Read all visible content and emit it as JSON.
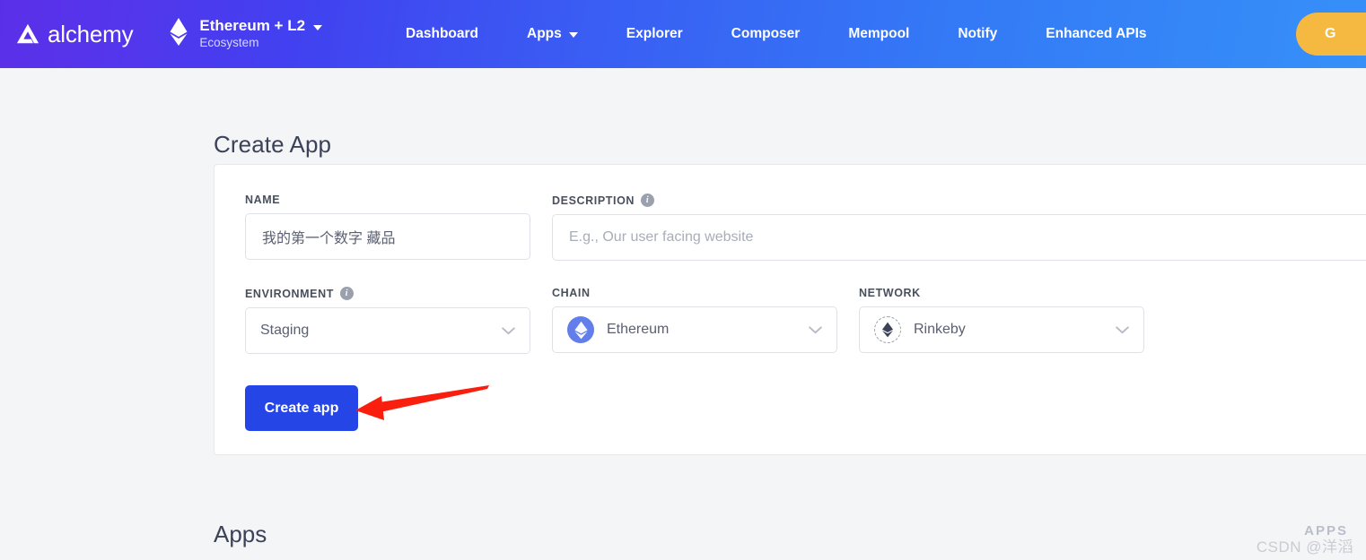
{
  "navbar": {
    "brand_name": "alchemy",
    "brand_logo_icon": "alchemy-triangle-logo",
    "ecosystem": {
      "icon": "ethereum-diamond-icon",
      "title": "Ethereum + L2",
      "subtitle": "Ecosystem",
      "caret_icon": "caret-down-icon"
    },
    "links": [
      {
        "label": "Dashboard",
        "has_caret": false
      },
      {
        "label": "Apps",
        "has_caret": true
      },
      {
        "label": "Explorer",
        "has_caret": false
      },
      {
        "label": "Composer",
        "has_caret": false
      },
      {
        "label": "Mempool",
        "has_caret": false
      },
      {
        "label": "Notify",
        "has_caret": false
      },
      {
        "label": "Enhanced APIs",
        "has_caret": false
      }
    ],
    "cta_label": "G",
    "gradient_start": "#5b2fe8",
    "gradient_end": "#3690f8",
    "cta_color": "#f5b942"
  },
  "create_app": {
    "heading": "Create App",
    "name": {
      "label": "NAME",
      "value": "我的第一个数字 藏品",
      "placeholder": "我的第一个数字 藏品"
    },
    "description": {
      "label": "DESCRIPTION",
      "info_icon": "info-icon",
      "value": "",
      "placeholder": "E.g., Our user facing website"
    },
    "environment": {
      "label": "ENVIRONMENT",
      "info_icon": "info-icon",
      "value": "Staging",
      "chevron_icon": "chevron-down-icon"
    },
    "chain": {
      "label": "CHAIN",
      "value": "Ethereum",
      "icon": "ethereum-circle-icon",
      "icon_color": "#627eea",
      "chevron_icon": "chevron-down-icon"
    },
    "network": {
      "label": "NETWORK",
      "value": "Rinkeby",
      "icon": "ethereum-dashed-circle-icon",
      "chevron_icon": "chevron-down-icon"
    },
    "submit_label": "Create app",
    "submit_color": "#2545e6"
  },
  "apps_section": {
    "heading": "Apps",
    "ghost_label": "APPS"
  },
  "annotation": {
    "arrow_icon": "red-arrow-pointing-left",
    "arrow_color": "#fa1e0e"
  },
  "watermark": {
    "text": "CSDN @洋滔"
  }
}
